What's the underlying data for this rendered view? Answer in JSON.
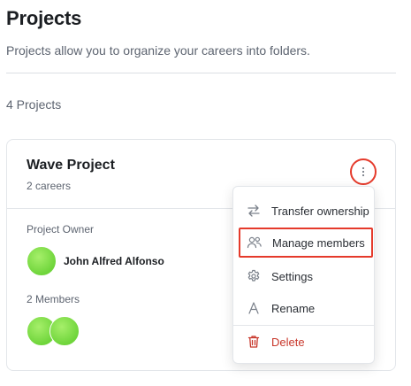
{
  "page": {
    "title": "Projects",
    "subtitle": "Projects allow you to organize your careers into folders.",
    "count_label": "4 Projects"
  },
  "project": {
    "name": "Wave Project",
    "careers_label": "2 careers",
    "owner_label": "Project Owner",
    "owner_name": "John Alfred Alfonso",
    "members_label": "2 Members",
    "avatar_color": "#7ddb45"
  },
  "menu": {
    "items": [
      {
        "label": "Transfer ownership",
        "icon": "transfer-icon"
      },
      {
        "label": "Manage members",
        "icon": "members-icon"
      },
      {
        "label": "Settings",
        "icon": "gear-icon"
      },
      {
        "label": "Rename",
        "icon": "rename-icon"
      },
      {
        "label": "Delete",
        "icon": "trash-icon"
      }
    ]
  },
  "colors": {
    "highlight": "#e53a2b",
    "danger": "#c8372b"
  }
}
